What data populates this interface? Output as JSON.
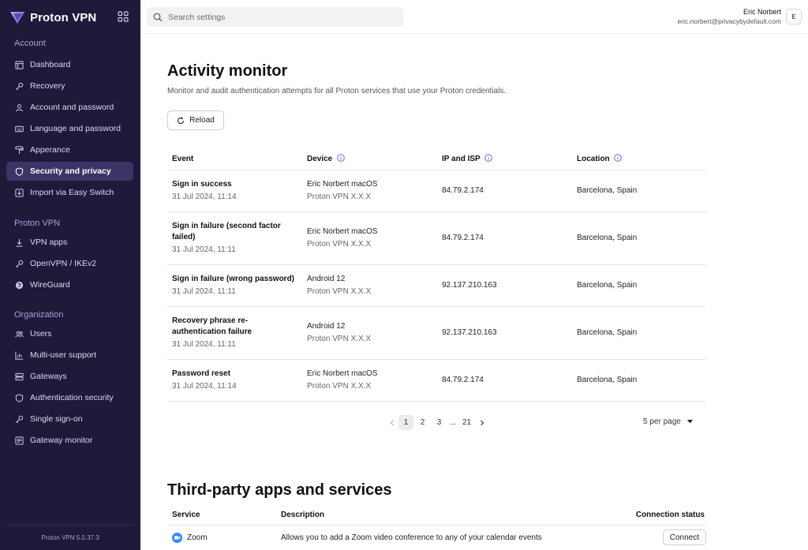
{
  "app": {
    "name": "Proton VPN",
    "version": "Proton VPN 5.0.37.3"
  },
  "sidebar": {
    "sections": [
      {
        "label": "Account"
      },
      {
        "label": "Proton VPN"
      },
      {
        "label": "Organization"
      }
    ],
    "items": [
      {
        "label": "Dashboard",
        "icon": "dashboard-icon"
      },
      {
        "label": "Recovery",
        "icon": "key-icon"
      },
      {
        "label": "Account and password",
        "icon": "user-icon"
      },
      {
        "label": "Language and password",
        "icon": "keyboard-icon"
      },
      {
        "label": "Apperance",
        "icon": "paint-roller-icon"
      },
      {
        "label": "Security and privacy",
        "icon": "shield-icon",
        "active": true
      },
      {
        "label": "Import via Easy Switch",
        "icon": "import-icon"
      },
      {
        "label": "VPN apps",
        "icon": "download-icon"
      },
      {
        "label": "OpenVPN / IKEv2",
        "icon": "key-icon"
      },
      {
        "label": "WireGuard",
        "icon": "wireguard-icon"
      },
      {
        "label": "Users",
        "icon": "users-icon"
      },
      {
        "label": "Multi-user support",
        "icon": "chart-icon"
      },
      {
        "label": "Gateways",
        "icon": "server-icon"
      },
      {
        "label": "Authentication security",
        "icon": "shield-icon"
      },
      {
        "label": "Single sign-on",
        "icon": "key-icon"
      },
      {
        "label": "Gateway monitor",
        "icon": "monitor-list-icon"
      }
    ]
  },
  "topbar": {
    "search_placeholder": "Search settings",
    "user_name": "Eric Norbert",
    "user_email": "eric.norbert@privacybydefault.com",
    "avatar_initial": "E"
  },
  "activity": {
    "title": "Activity monitor",
    "description": "Monitor and audit authentication attempts for all Proton services that use your Proton credentials.",
    "reload_label": "Reload",
    "columns": [
      "Event",
      "Device",
      "IP and ISP",
      "Location"
    ],
    "rows": [
      {
        "event": "Sign in success",
        "time": "31 Jul 2024, 11:14",
        "device": "Eric Norbert macOS",
        "app": "Proton VPN X.X.X",
        "ip": "84.79.2.174",
        "location": "Barcelona, Spain"
      },
      {
        "event": "Sign in failure (second factor failed)",
        "time": "31 Jul 2024, 11:11",
        "device": "Eric Norbert macOS",
        "app": "Proton VPN X.X.X",
        "ip": "84.79.2.174",
        "location": "Barcelona, Spain"
      },
      {
        "event": "Sign in failure (wrong password)",
        "time": "31 Jul 2024, 11:11",
        "device": "Android 12",
        "app": "Proton VPN X.X.X",
        "ip": "92.137.210.163",
        "location": "Barcelona, Spain"
      },
      {
        "event": "Recovery phrase re-authentication failure",
        "time": "31 Jul 2024, 11:11",
        "device": "Android 12",
        "app": "Proton VPN X.X.X",
        "ip": "92.137.210.163",
        "location": "Barcelona, Spain"
      },
      {
        "event": "Password reset",
        "time": "31 Jul 2024, 11:14",
        "device": "Eric Norbert macOS",
        "app": "Proton VPN X.X.X",
        "ip": "84.79.2.174",
        "location": "Barcelona, Spain"
      }
    ],
    "pagination": {
      "pages": [
        "1",
        "2",
        "3"
      ],
      "ellipsis": "...",
      "last": "21",
      "current": "1",
      "per_page_label": "5 per page"
    }
  },
  "third_party": {
    "title": "Third-party apps and services",
    "columns": [
      "Service",
      "Description",
      "Connection status"
    ],
    "rows": [
      {
        "service": "Zoom",
        "description": "Allows you to add a Zoom video conference to any of your calendar events",
        "action": "Connect"
      }
    ]
  },
  "colors": {
    "sidebar_bg": "#1f1a3a",
    "sidebar_active": "#3b3466",
    "accent": "#6d4aff"
  }
}
